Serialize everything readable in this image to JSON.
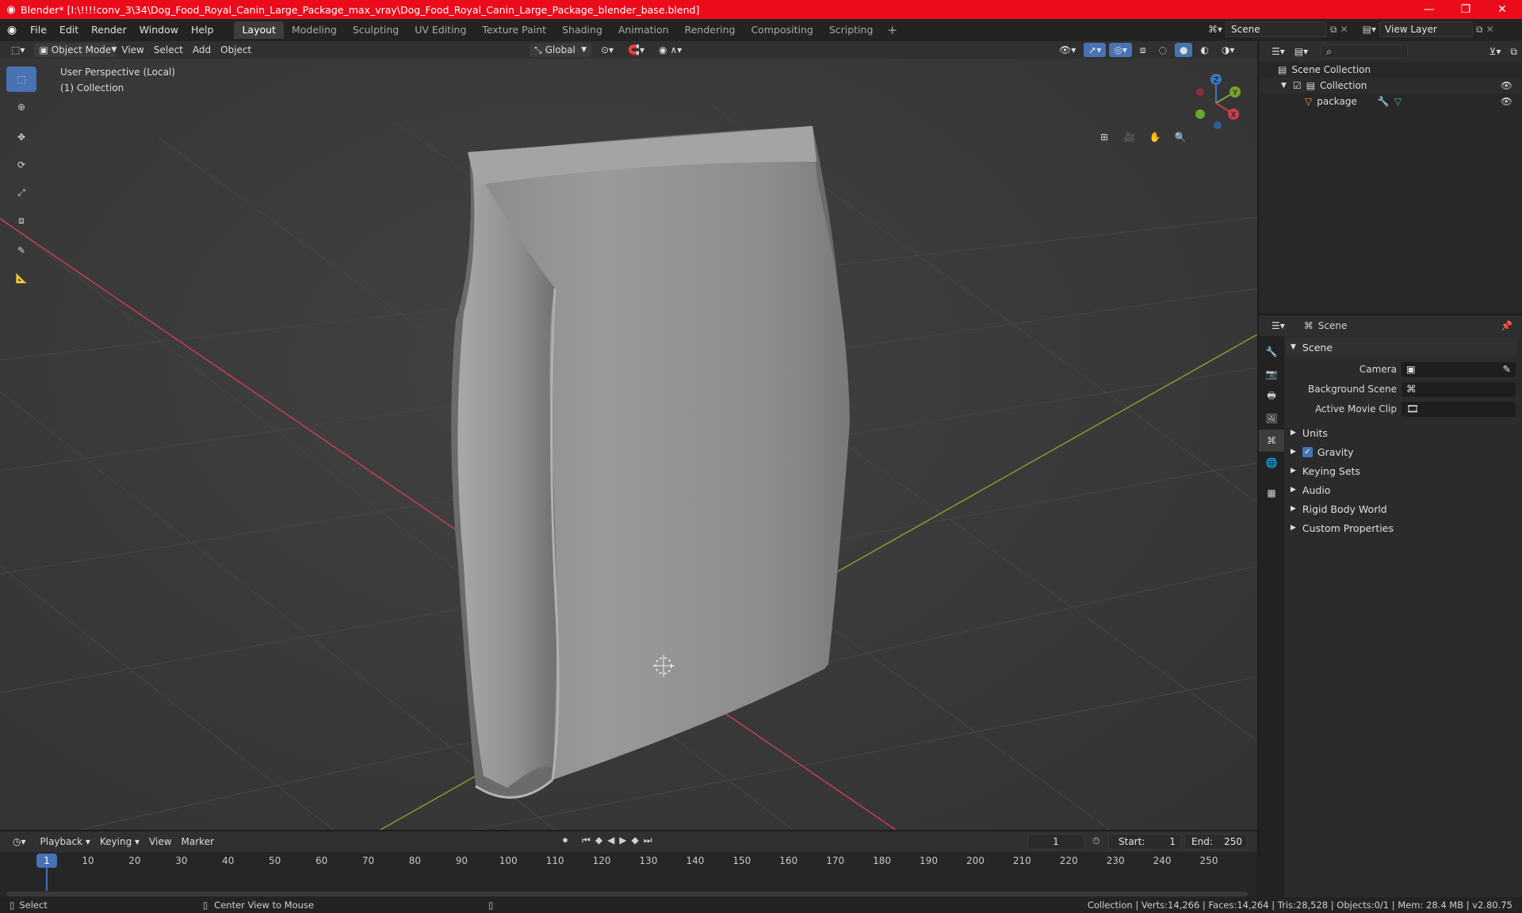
{
  "window": {
    "title": "Blender* [I:\\!!!!conv_3\\34\\Dog_Food_Royal_Canin_Large_Package_max_vray\\Dog_Food_Royal_Canin_Large_Package_blender_base.blend]",
    "minimize": "—",
    "maximize": "❐",
    "close": "✕"
  },
  "menu": {
    "items": [
      "File",
      "Edit",
      "Render",
      "Window",
      "Help"
    ],
    "workspaces": [
      "Layout",
      "Modeling",
      "Sculpting",
      "UV Editing",
      "Texture Paint",
      "Shading",
      "Animation",
      "Rendering",
      "Compositing",
      "Scripting"
    ],
    "add_workspace": "+",
    "scene": "Scene",
    "view_layer": "View Layer"
  },
  "viewport_header": {
    "mode": "Object Mode",
    "menus": [
      "View",
      "Select",
      "Add",
      "Object"
    ],
    "orientation": "Global"
  },
  "viewport": {
    "view_label": "User Perspective (Local)",
    "collection_label": "(1) Collection",
    "gizmo": {
      "z": "Z",
      "y": "Y",
      "x": "X"
    }
  },
  "outliner": {
    "root": "Scene Collection",
    "collection": "Collection",
    "object": "package"
  },
  "properties": {
    "header": "Scene",
    "panel": "Scene",
    "camera_label": "Camera",
    "background_label": "Background Scene",
    "movie_clip_label": "Active Movie Clip",
    "sections": [
      "Units",
      "Gravity",
      "Keying Sets",
      "Audio",
      "Rigid Body World",
      "Custom Properties"
    ],
    "gravity_checked": true
  },
  "timeline": {
    "menus": [
      "Playback",
      "Keying",
      "View",
      "Marker"
    ],
    "current_frame": "1",
    "start_label": "Start:",
    "start": "1",
    "end_label": "End:",
    "end": "250",
    "ticks": [
      "1",
      "10",
      "20",
      "30",
      "40",
      "50",
      "60",
      "70",
      "80",
      "90",
      "100",
      "110",
      "120",
      "130",
      "140",
      "150",
      "160",
      "170",
      "180",
      "190",
      "200",
      "210",
      "220",
      "230",
      "240",
      "250"
    ]
  },
  "status": {
    "select": "Select",
    "center_view": "Center View to Mouse",
    "stats": "Collection | Verts:14,266 | Faces:14,264 | Tris:28,528 | Objects:0/1 | Mem: 28.4 MB | v2.80.75"
  },
  "colors": {
    "title_bar": "#ea0b1b",
    "accent": "#4772b3",
    "axis_x": "#c6404e",
    "axis_y": "#7fa12b"
  }
}
